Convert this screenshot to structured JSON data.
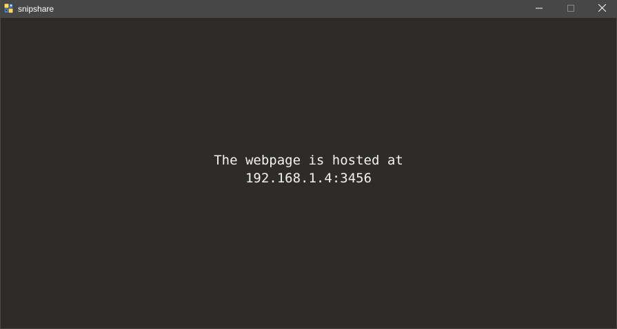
{
  "window": {
    "title": "snipshare",
    "icon": "python-icon",
    "controls": {
      "minimize": "minimize-icon",
      "maximize": "maximize-icon",
      "close": "close-icon"
    }
  },
  "content": {
    "line1": "The webpage is hosted at",
    "line2": "192.168.1.4:3456"
  },
  "colors": {
    "background": "#2d2c29",
    "titlebar": "#474747",
    "text": "#f2f2f2"
  }
}
